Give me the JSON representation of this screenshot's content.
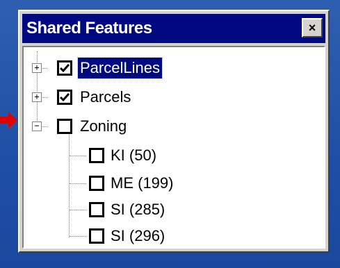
{
  "window": {
    "title": "Shared Features",
    "close_glyph": "×"
  },
  "tree": {
    "items": [
      {
        "label": "ParcelLines",
        "checked": true,
        "expander": "+",
        "selected": true
      },
      {
        "label": "Parcels",
        "checked": true,
        "expander": "+",
        "selected": false
      },
      {
        "label": "Zoning",
        "checked": false,
        "expander": "−",
        "selected": false,
        "children": [
          {
            "label": "KI (50)",
            "checked": false
          },
          {
            "label": "ME (199)",
            "checked": false
          },
          {
            "label": "SI (285)",
            "checked": false
          },
          {
            "label": "SI (296)",
            "checked": false
          }
        ]
      }
    ]
  },
  "annotation": {
    "pointer_color": "#e00000",
    "pointer_icon": "red-arrow-icon"
  },
  "colors": {
    "desktop": "#1f4ea6",
    "titlebar": "#000a80",
    "selection": "#000a80",
    "window_face": "#d6d3ce"
  }
}
